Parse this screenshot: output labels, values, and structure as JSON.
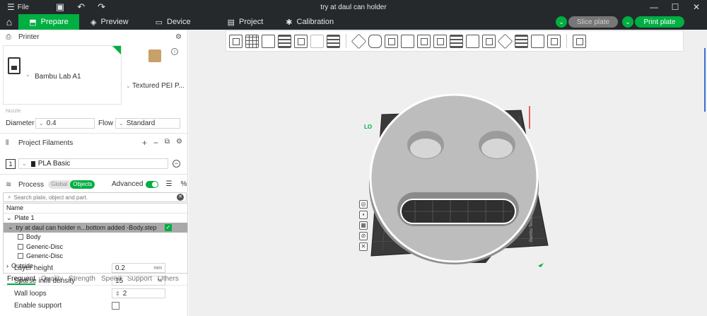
{
  "titlebar": {
    "menu_label": "File",
    "title": "try at daul can holder",
    "icons": [
      "hamburger-icon",
      "save-icon",
      "undo-icon",
      "redo-icon"
    ]
  },
  "nav": {
    "tabs": [
      {
        "label": "Prepare",
        "active": true
      },
      {
        "label": "Preview"
      },
      {
        "label": "Device"
      },
      {
        "label": "Project"
      },
      {
        "label": "Calibration"
      }
    ],
    "slice_label": "Slice plate",
    "print_label": "Print plate"
  },
  "printer": {
    "section_title": "Printer",
    "name": "Bambu Lab A1",
    "plate_type": "Textured PEI P...",
    "nozzle_label": "Nozzle",
    "diameter_label": "Diameter",
    "diameter_value": "0.4",
    "flow_label": "Flow",
    "flow_value": "Standard"
  },
  "filaments": {
    "section_title": "Project Filaments",
    "items": [
      {
        "index": "1",
        "name": "PLA Basic",
        "color": "#222222"
      }
    ]
  },
  "process": {
    "section_title": "Process",
    "toggle_global": "Global",
    "toggle_objects": "Objects",
    "advanced_label": "Advanced",
    "search_placeholder": "Search plate, object and part."
  },
  "tree": {
    "header": "Name",
    "rows": [
      {
        "label": "Plate 1",
        "prefix": "⌄"
      },
      {
        "label": "try at daul can holder n...bottom added -Body.step",
        "prefix": "⌄"
      },
      {
        "label": "Body"
      },
      {
        "label": "Generic-Disc"
      },
      {
        "label": "Generic-Disc"
      },
      {
        "label": "Outside",
        "prefix": "›"
      }
    ]
  },
  "settings": {
    "tabs": [
      "Frequent",
      "Quality",
      "Strength",
      "Speed",
      "Support",
      "Others"
    ],
    "rows": [
      {
        "label": "Layer height",
        "value": "0.2",
        "unit": "mm"
      },
      {
        "label": "Sparse infill density",
        "value": "15",
        "unit": "%"
      },
      {
        "label": "Wall loops",
        "value": "2"
      },
      {
        "label": "Enable support"
      }
    ]
  },
  "viewport": {
    "plate_label": "LO",
    "bed_brand": "Bambu Textu"
  },
  "colors": {
    "accent": "#00ae42",
    "titlebar": "#25292c",
    "model": "#bdbdbd",
    "bed": "#3a3a3a"
  }
}
